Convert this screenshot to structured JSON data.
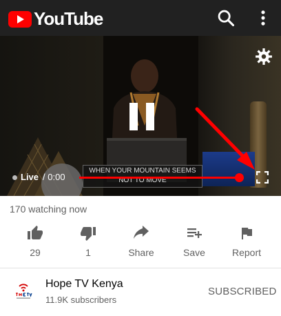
{
  "app": {
    "logo_text": "YouTube",
    "brand_color": "#ff0000"
  },
  "topbar": {
    "search_icon": "search-icon",
    "menu_icon": "more-vert-icon"
  },
  "player": {
    "overlay_line1": "WHEN YOUR MOUNTAIN SEEMS",
    "overlay_line2": "NOT TO MOVE",
    "live_label": "Live",
    "separator": "/",
    "time": "0:00",
    "state": "paused",
    "progress_fraction": 0.98
  },
  "watching": "170 watching now",
  "actions": {
    "like": {
      "label": "29",
      "icon": "thumb-up-icon"
    },
    "dislike": {
      "label": "1",
      "icon": "thumb-down-icon"
    },
    "share": {
      "label": "Share",
      "icon": "share-icon"
    },
    "save": {
      "label": "Save",
      "icon": "playlist-add-icon"
    },
    "report": {
      "label": "Report",
      "icon": "flag-icon"
    }
  },
  "channel": {
    "name": "Hope TV Kenya",
    "subscribers": "11.9K subscribers",
    "subscribe_state": "SUBSCRIBED"
  }
}
